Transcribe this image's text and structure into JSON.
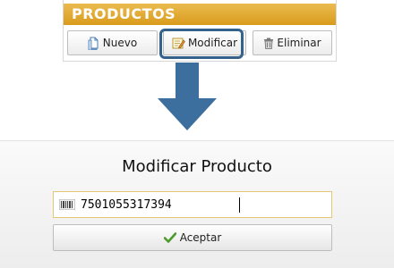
{
  "top_panel": {
    "title": "PRODUCTOS",
    "buttons": {
      "nuevo": {
        "label": "Nuevo",
        "icon": "new-document-icon"
      },
      "modificar": {
        "label": "Modificar",
        "icon": "edit-icon"
      },
      "eliminar": {
        "label": "Eliminar",
        "icon": "trash-icon"
      }
    },
    "highlighted_button": "modificar"
  },
  "arrow": {
    "direction": "down",
    "color": "#3c6e9e"
  },
  "dialog": {
    "title": "Modificar Producto",
    "code_field": {
      "value": "7501055317394",
      "icon": "barcode-icon"
    },
    "accept_button": {
      "label": "Aceptar",
      "icon": "checkmark-icon"
    }
  },
  "colors": {
    "header_gradient_top": "#ebbb4f",
    "header_gradient_bottom": "#d99b1c",
    "highlight_border": "#34628c",
    "field_border": "#e3c774",
    "check_green": "#4a9a2c"
  }
}
